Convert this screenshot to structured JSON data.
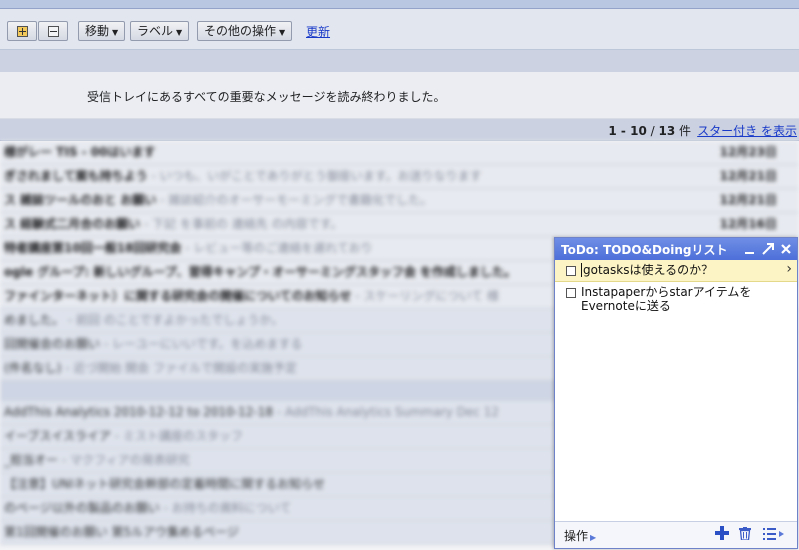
{
  "toolbar": {
    "expand_label": "+",
    "collapse_label": "−",
    "move_label": "移動",
    "label_label": "ラベル",
    "more_actions_label": "その他の操作",
    "refresh_label": "更新"
  },
  "notice": {
    "text": "受信トレイにあるすべての重要なメッセージを読み終わりました。"
  },
  "pagination": {
    "range": "1 - 10",
    "separator": " / ",
    "total": "13",
    "unit": " 件",
    "starred_link": "スター付き を表示"
  },
  "mail_list": {
    "rows": [
      {
        "text": "様がレー TIS - 00はいます",
        "snippet": "",
        "date": "12月23日",
        "style": "unread"
      },
      {
        "text": "ぎされまして案も持ちよう",
        "snippet": " - いつも、いがことでありがとう御座います。お送りなります",
        "date": "12月21日",
        "style": "unread"
      },
      {
        "text": "ス 雑誌ツールのおと お願い",
        "snippet": " - 雑誌紹介のオーサーモーミングで書籍化でした。",
        "date": "12月21日",
        "style": "unread"
      },
      {
        "text": "ス 経験式二月合のお願い",
        "snippet": " - 下記 を事前の 連絡先 の内容です。",
        "date": "12月16日",
        "style": "unread"
      },
      {
        "text": "特者講座第10回一般18回研究会",
        "snippet": " - レビュー等のご連絡を遅れており",
        "date": "12月13日",
        "style": "unread"
      },
      {
        "text": "ogle グループ: 新しいグループ、習得キャンプ・オーサーミングスタッフ会 を作成しました。",
        "snippet": "",
        "date": "",
        "style": "unread"
      },
      {
        "text": "ファインターネット）に関する研究会の開催についてのお知らせ",
        "snippet": " - スケーリングについて 様",
        "date": "",
        "style": "unread"
      },
      {
        "text": "めました。",
        "snippet": " - 前回 のことですよかったでしょうか。",
        "date": "",
        "style": "read"
      },
      {
        "text": "回開催会のお願い",
        "snippet": " - レーユーにいいです。を込めまする",
        "date": "",
        "style": "read"
      },
      {
        "text": "(件名なし)",
        "snippet": " - 近づ開始 開会 ファイルで開設の実施予定",
        "date": "",
        "style": "read"
      },
      {
        "text": "AddThis Analytics 2010-12-12 to 2010-12-18",
        "snippet": " - AddThis Analytics Summary Dec 12",
        "date": "",
        "style": "read"
      },
      {
        "text": "イーブスイスライア",
        "snippet": " - ミスト講座のスタッフ",
        "date": "",
        "style": "read"
      },
      {
        "text": "_担当オー",
        "snippet": " - マクフィアの発表研究",
        "date": "",
        "style": "read"
      },
      {
        "text": "【注意】UNIネット研究会幹部の定着時間に関するお知らせ",
        "snippet": "",
        "date": "",
        "style": "read"
      },
      {
        "text": "のページ以外の製品のお願い",
        "snippet": " - お持ちの資料について",
        "date": "",
        "style": "read"
      },
      {
        "text": "第1回開催のお願い 第5ルアウ集めるページ",
        "snippet": "",
        "date": "",
        "style": "read"
      }
    ]
  },
  "todo": {
    "title": "ToDo: TODO&Doingリスト",
    "tasks": [
      {
        "text": "gotasksは使えるのか？",
        "selected": true
      },
      {
        "text": "Instapaperからstarアイテムを Evernoteに送る",
        "selected": false
      }
    ],
    "footer": {
      "actions_label": "操作"
    }
  },
  "icons": {
    "minimize": "minimize-icon",
    "popout": "popout-arrow-icon",
    "close": "close-icon",
    "add": "plus-icon",
    "delete": "trash-icon",
    "lists": "list-switch-icon"
  },
  "colors": {
    "todo_header": "#4d6fd8",
    "link": "#1a3ccf",
    "selected_task": "#fcf4c4"
  }
}
